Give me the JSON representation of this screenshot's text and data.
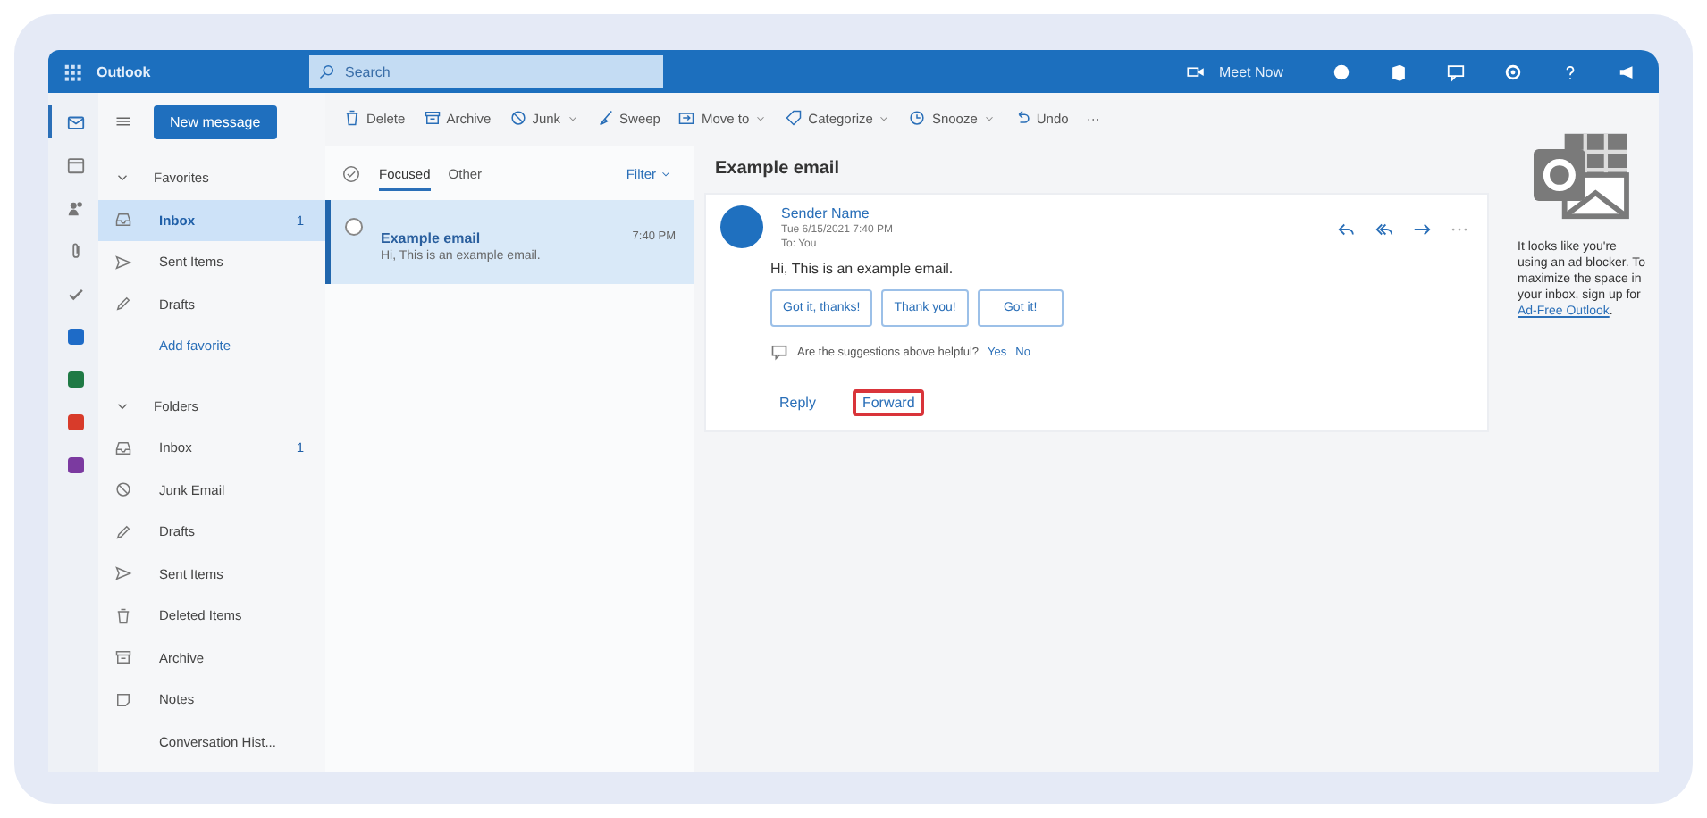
{
  "topbar": {
    "app_name": "Outlook",
    "search": {
      "placeholder": "Search"
    },
    "meet_now": "Meet Now"
  },
  "app_rail": [
    {
      "kind": "mail",
      "selected": true
    },
    {
      "kind": "calendar",
      "selected": false
    },
    {
      "kind": "people",
      "selected": false
    },
    {
      "kind": "attach",
      "selected": false
    },
    {
      "kind": "todo",
      "selected": false
    },
    {
      "kind": "word",
      "selected": false
    },
    {
      "kind": "excel",
      "selected": false
    },
    {
      "kind": "powerpoint",
      "selected": false
    },
    {
      "kind": "onenote",
      "selected": false
    }
  ],
  "folder_pane": {
    "new_message": "New message",
    "favorites": {
      "label": "Favorites",
      "expanded": true,
      "items": [
        {
          "label": "Inbox",
          "kind": "inbox",
          "count": "1",
          "selected": true
        },
        {
          "label": "Sent Items",
          "kind": "sent",
          "selected": false
        },
        {
          "label": "Drafts",
          "kind": "drafts",
          "selected": false
        }
      ]
    },
    "add_favorite": "Add favorite",
    "folders": {
      "label": "Folders",
      "expanded": true,
      "items": [
        {
          "label": "Inbox",
          "kind": "inbox",
          "count": "1",
          "selected": false
        },
        {
          "label": "Junk Email",
          "kind": "junk",
          "selected": false
        },
        {
          "label": "Drafts",
          "kind": "drafts",
          "selected": false
        },
        {
          "label": "Sent Items",
          "kind": "sent",
          "selected": false
        },
        {
          "label": "Deleted Items",
          "kind": "deleted",
          "selected": false
        },
        {
          "label": "Archive",
          "kind": "archive",
          "selected": false
        },
        {
          "label": "Notes",
          "kind": "notes",
          "selected": false
        },
        {
          "label": "Conversation Hist...",
          "kind": "none",
          "selected": false
        }
      ]
    }
  },
  "toolbar": [
    {
      "label": "Delete",
      "kind": "delete",
      "dropdown": false
    },
    {
      "label": "Archive",
      "kind": "archive",
      "dropdown": false
    },
    {
      "label": "Junk",
      "kind": "junk",
      "dropdown": true
    },
    {
      "label": "Sweep",
      "kind": "sweep",
      "dropdown": false
    },
    {
      "label": "Move to",
      "kind": "move",
      "dropdown": true
    },
    {
      "label": "Categorize",
      "kind": "tag",
      "dropdown": true
    },
    {
      "label": "Snooze",
      "kind": "clock",
      "dropdown": true
    },
    {
      "label": "Undo",
      "kind": "undo",
      "dropdown": false
    },
    {
      "label": "···",
      "kind": "more",
      "dropdown": false
    }
  ],
  "message_list": {
    "tabs": [
      {
        "label": "Focused",
        "selected": true
      },
      {
        "label": "Other",
        "selected": false
      }
    ],
    "filter": "Filter",
    "messages": [
      {
        "subject": "Example email",
        "time": "7:40 PM",
        "preview": "Hi, This is an example email.",
        "selected": true
      }
    ]
  },
  "reading_pane": {
    "subject": "Example email",
    "sender": "Sender Name",
    "date": "Tue 6/15/2021 7:40 PM",
    "to": "To: You",
    "body": "Hi, This is an example email.",
    "suggestions": [
      "Got it, thanks!",
      "Thank you!",
      "Got it!"
    ],
    "feedback": {
      "question": "Are the suggestions above helpful?",
      "yes": "Yes",
      "no": "No"
    },
    "actions": [
      {
        "label": "Reply",
        "highlighted": false
      },
      {
        "label": "Forward",
        "highlighted": true
      }
    ]
  },
  "ad_pane": {
    "text": "It looks like you're using an ad blocker. To maximize the space in your inbox, sign up for ",
    "link": "Ad-Free Outlook",
    "end": "."
  }
}
